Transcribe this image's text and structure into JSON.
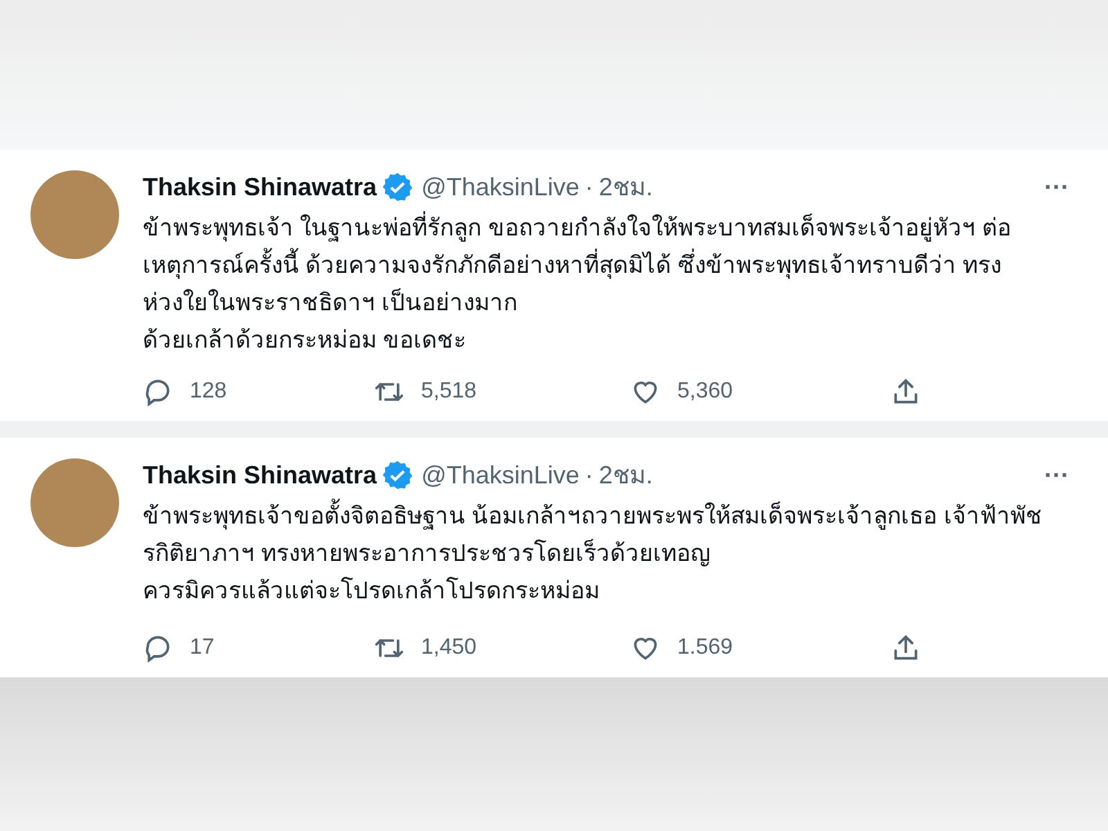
{
  "tweets": [
    {
      "name": "Thaksin Shinawatra",
      "verified": true,
      "handle": "@ThaksinLive",
      "separator": "·",
      "time": "2ชม.",
      "more": "···",
      "text": "ข้าพระพุทธเจ้า ในฐานะพ่อที่รักลูก ขอถวายกำลังใจให้พระบาทสมเด็จพระเจ้าอยู่หัวฯ ต่อเหตุการณ์ครั้งนี้ ด้วยความจงรักภักดีอย่างหาที่สุดมิได้ ซึ่งข้าพระพุทธเจ้าทราบดีว่า ทรงห่วงใยในพระราชธิดาฯ เป็นอย่างมาก\nด้วยเกล้าด้วยกระหม่อม ขอเดชะ",
      "replies": "128",
      "retweets": "5,518",
      "likes": "5,360"
    },
    {
      "name": "Thaksin Shinawatra",
      "verified": true,
      "handle": "@ThaksinLive",
      "separator": "·",
      "time": "2ชม.",
      "more": "···",
      "text": "ข้าพระพุทธเจ้าขอตั้งจิตอธิษฐาน น้อมเกล้าฯถวายพระพรให้สมเด็จพระเจ้าลูกเธอ เจ้าฟ้าพัชรกิติยาภาฯ ทรงหายพระอาการประชวรโดยเร็วด้วยเทอญ\nควรมิควรแล้วแต่จะโปรดเกล้าโปรดกระหม่อม",
      "replies": "17",
      "retweets": "1,450",
      "likes": "1.569"
    }
  ]
}
